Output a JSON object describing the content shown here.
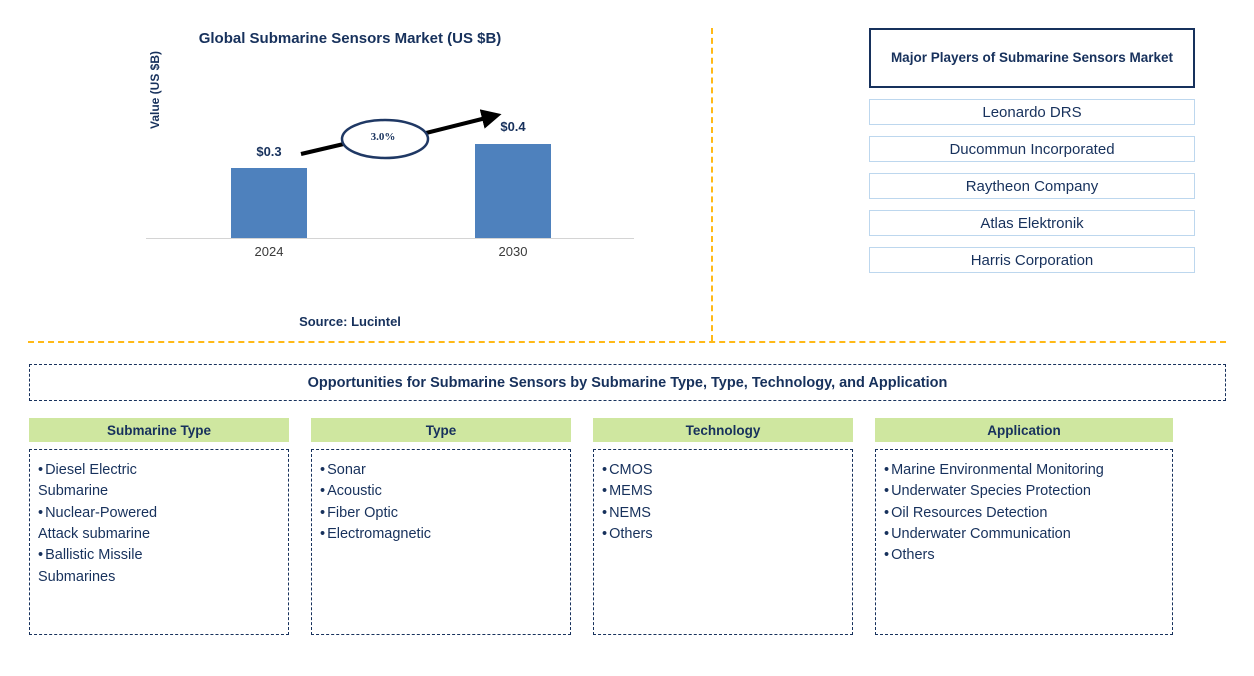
{
  "chart_data": {
    "type": "bar",
    "title": "Global Submarine Sensors Market (US $B)",
    "ylabel": "Value (US $B)",
    "xlabel": "",
    "categories": [
      "2024",
      "2030"
    ],
    "values": [
      0.3,
      0.4
    ],
    "value_labels": [
      "$0.3",
      "$0.4"
    ],
    "cagr_label": "3.0%",
    "ylim": [
      0,
      0.5
    ],
    "grid": false,
    "legend": "none",
    "bar_color": "#4E81BD",
    "source": "Source: Lucintel"
  },
  "chart": {
    "title": "Global Submarine Sensors Market (US $B)",
    "y_axis_label": "Value (US $B)",
    "tick_2024": "2024",
    "tick_2030": "2030",
    "value_2024": "$0.3",
    "value_2030": "$0.4",
    "cagr": "3.0%",
    "source": "Source: Lucintel"
  },
  "players": {
    "header": "Major Players of Submarine Sensors Market",
    "items": [
      {
        "name": "Leonardo DRS"
      },
      {
        "name": "Ducommun Incorporated"
      },
      {
        "name": "Raytheon Company"
      },
      {
        "name": "Atlas Elektronik"
      },
      {
        "name": "Harris Corporation"
      }
    ]
  },
  "opportunities": {
    "title": "Opportunities for Submarine Sensors by Submarine Type, Type, Technology, and Application",
    "columns": [
      {
        "header": "Submarine Type",
        "items": [
          "Diesel Electric\nSubmarine",
          "Nuclear-Powered\nAttack submarine",
          "Ballistic Missile\nSubmarines"
        ]
      },
      {
        "header": "Type",
        "items": [
          "Sonar",
          "Acoustic",
          "Fiber Optic",
          "Electromagnetic"
        ]
      },
      {
        "header": "Technology",
        "items": [
          "CMOS",
          "MEMS",
          "NEMS",
          "Others"
        ]
      },
      {
        "header": "Application",
        "items": [
          "Marine Environmental Monitoring",
          "Underwater Species Protection",
          "Oil Resources Detection",
          "Underwater Communication",
          "Others"
        ]
      }
    ]
  },
  "colors": {
    "navy": "#17315C",
    "bar_blue": "#4E81BD",
    "divider_orange": "#FFB917",
    "header_green": "#CFE7A0",
    "player_border": "#BDD7EE"
  }
}
